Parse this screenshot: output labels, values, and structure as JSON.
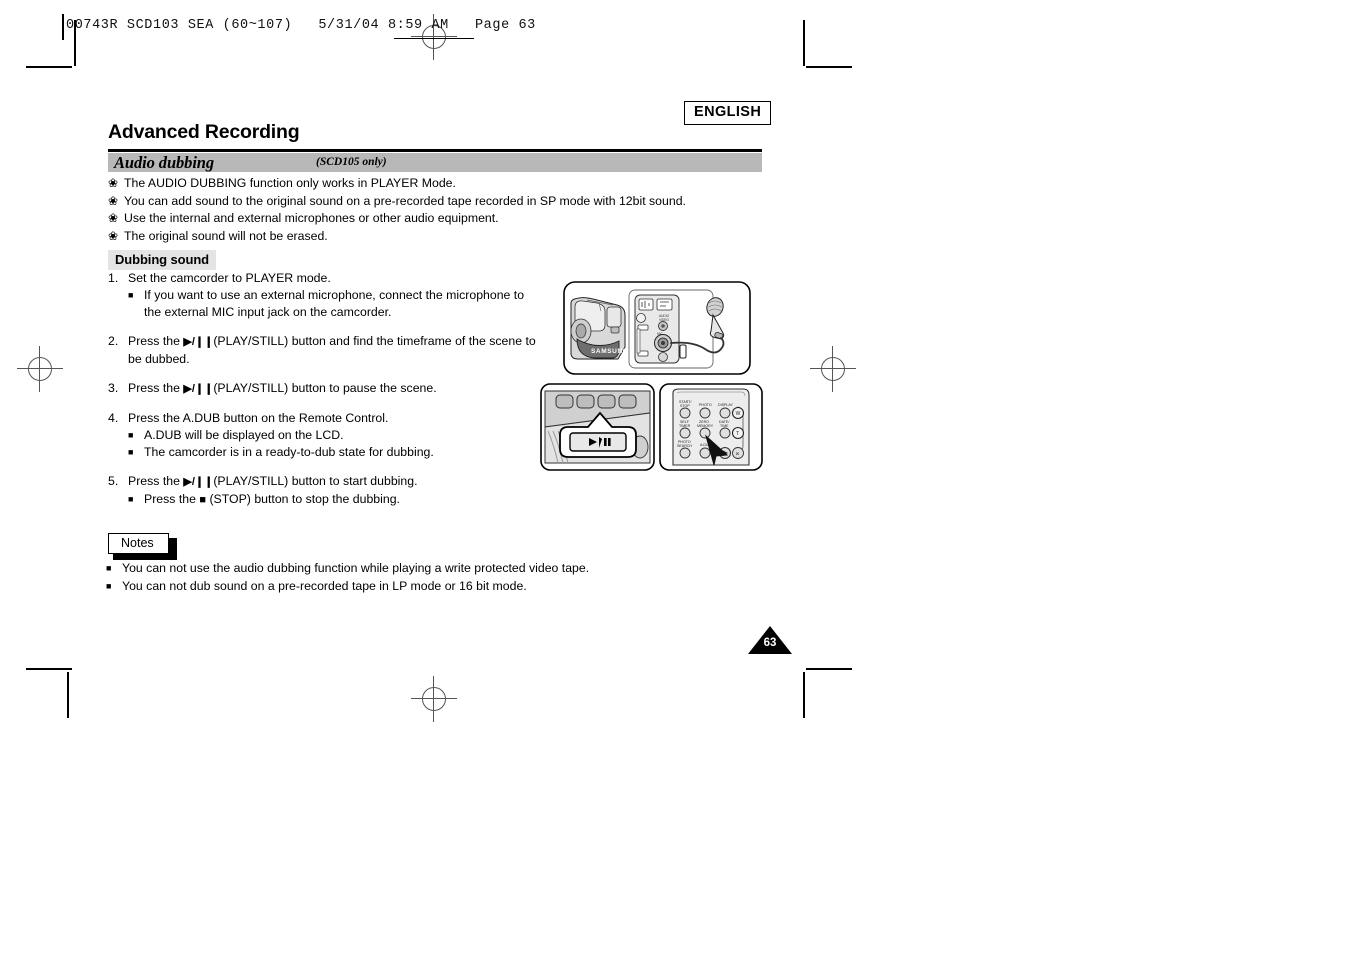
{
  "slug": {
    "text": "00743R SCD103 SEA (60~107)   5/31/04 8:59 AM   Page 63"
  },
  "header": {
    "language_badge": "ENGLISH",
    "chapter_title": "Advanced Recording",
    "section_title": "Audio dubbing",
    "section_subtitle": "(SCD105 only)"
  },
  "intro_bullets": [
    {
      "glyph": "❀",
      "text": "The AUDIO DUBBING function only works in PLAYER Mode."
    },
    {
      "glyph": "❀",
      "text": "You can add sound to the original sound on a pre-recorded tape recorded in SP mode with 12bit sound."
    },
    {
      "glyph": "❀",
      "text": "Use the internal and external microphones or other audio equipment."
    },
    {
      "glyph": "❀",
      "text": "The original sound will not be erased."
    }
  ],
  "procedure": {
    "subhead": "Dubbing sound",
    "steps": [
      {
        "num": "1.",
        "text": "Set the camcorder to PLAYER mode.",
        "subs": [
          {
            "glyph": "■",
            "text": "If you want to use an external microphone, connect the microphone to"
          },
          {
            "glyph": "",
            "text": "the external MIC input jack on the camcorder."
          }
        ]
      },
      {
        "num": "2.",
        "pre": "Press the",
        "icon": "▶/❙❙",
        "post": "(PLAY/STILL) button and find the timeframe of the scene to",
        "line2": "be dubbed.",
        "subs": []
      },
      {
        "num": "3.",
        "pre": "Press the",
        "icon": "▶/❙❙",
        "post": "(PLAY/STILL) button to pause the scene.",
        "subs": []
      },
      {
        "num": "4.",
        "text": "Press the A.DUB button on the Remote Control.",
        "subs": [
          {
            "glyph": "■",
            "text": "A.DUB will be displayed on the LCD."
          },
          {
            "glyph": "■",
            "text": "The camcorder is in a ready-to-dub state for dubbing."
          }
        ]
      },
      {
        "num": "5.",
        "pre": "Press the",
        "icon": "▶/❙❙",
        "post": "(PLAY/STILL) button to start dubbing.",
        "subs": [
          {
            "glyph": "■",
            "pre": "Press the",
            "icon": "■",
            "post": "(STOP) button to stop the dubbing."
          }
        ]
      }
    ]
  },
  "notes": {
    "label": "Notes",
    "items": [
      {
        "glyph": "■",
        "text": "You can not use the audio dubbing function while playing a write protected video tape."
      },
      {
        "glyph": "■",
        "text": "You can not dub sound on a pre-recorded tape in LP mode or 16 bit mode."
      }
    ]
  },
  "figures": {
    "camcorder_mic": {
      "brand_label": "SAMSUNG",
      "caption": "camcorder-with-external-microphone"
    },
    "play_still_button": {
      "button_label": "▶/❙❙",
      "caption": "camcorder-play-still-button-closeup"
    },
    "remote_control": {
      "caption": "remote-control-a-dub-button",
      "buttons": [
        "START/ STOP",
        "PHOTO",
        "DISPLAY",
        "SELF TIMER",
        "ZERO MEMORY",
        "DATE/ TIME",
        "PHOTO SEARCH",
        "A.DUB",
        "▶"
      ],
      "zoom_buttons": [
        "W",
        "T",
        "⌦"
      ]
    }
  },
  "footer": {
    "page_number": "63"
  },
  "colors": {
    "section_bar": "#b8b8b8",
    "subhead_bg": "#e4e4e4",
    "rule": "#000000"
  }
}
